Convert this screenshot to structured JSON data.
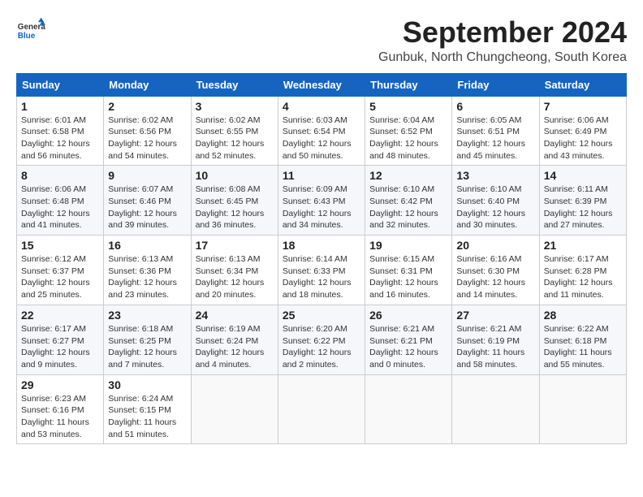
{
  "logo": {
    "general": "General",
    "blue": "Blue"
  },
  "header": {
    "month": "September 2024",
    "location": "Gunbuk, North Chungcheong, South Korea"
  },
  "weekdays": [
    "Sunday",
    "Monday",
    "Tuesday",
    "Wednesday",
    "Thursday",
    "Friday",
    "Saturday"
  ],
  "weeks": [
    [
      {
        "day": "1",
        "sunrise": "6:01 AM",
        "sunset": "6:58 PM",
        "daylight": "12 hours and 56 minutes."
      },
      {
        "day": "2",
        "sunrise": "6:02 AM",
        "sunset": "6:56 PM",
        "daylight": "12 hours and 54 minutes."
      },
      {
        "day": "3",
        "sunrise": "6:02 AM",
        "sunset": "6:55 PM",
        "daylight": "12 hours and 52 minutes."
      },
      {
        "day": "4",
        "sunrise": "6:03 AM",
        "sunset": "6:54 PM",
        "daylight": "12 hours and 50 minutes."
      },
      {
        "day": "5",
        "sunrise": "6:04 AM",
        "sunset": "6:52 PM",
        "daylight": "12 hours and 48 minutes."
      },
      {
        "day": "6",
        "sunrise": "6:05 AM",
        "sunset": "6:51 PM",
        "daylight": "12 hours and 45 minutes."
      },
      {
        "day": "7",
        "sunrise": "6:06 AM",
        "sunset": "6:49 PM",
        "daylight": "12 hours and 43 minutes."
      }
    ],
    [
      {
        "day": "8",
        "sunrise": "6:06 AM",
        "sunset": "6:48 PM",
        "daylight": "12 hours and 41 minutes."
      },
      {
        "day": "9",
        "sunrise": "6:07 AM",
        "sunset": "6:46 PM",
        "daylight": "12 hours and 39 minutes."
      },
      {
        "day": "10",
        "sunrise": "6:08 AM",
        "sunset": "6:45 PM",
        "daylight": "12 hours and 36 minutes."
      },
      {
        "day": "11",
        "sunrise": "6:09 AM",
        "sunset": "6:43 PM",
        "daylight": "12 hours and 34 minutes."
      },
      {
        "day": "12",
        "sunrise": "6:10 AM",
        "sunset": "6:42 PM",
        "daylight": "12 hours and 32 minutes."
      },
      {
        "day": "13",
        "sunrise": "6:10 AM",
        "sunset": "6:40 PM",
        "daylight": "12 hours and 30 minutes."
      },
      {
        "day": "14",
        "sunrise": "6:11 AM",
        "sunset": "6:39 PM",
        "daylight": "12 hours and 27 minutes."
      }
    ],
    [
      {
        "day": "15",
        "sunrise": "6:12 AM",
        "sunset": "6:37 PM",
        "daylight": "12 hours and 25 minutes."
      },
      {
        "day": "16",
        "sunrise": "6:13 AM",
        "sunset": "6:36 PM",
        "daylight": "12 hours and 23 minutes."
      },
      {
        "day": "17",
        "sunrise": "6:13 AM",
        "sunset": "6:34 PM",
        "daylight": "12 hours and 20 minutes."
      },
      {
        "day": "18",
        "sunrise": "6:14 AM",
        "sunset": "6:33 PM",
        "daylight": "12 hours and 18 minutes."
      },
      {
        "day": "19",
        "sunrise": "6:15 AM",
        "sunset": "6:31 PM",
        "daylight": "12 hours and 16 minutes."
      },
      {
        "day": "20",
        "sunrise": "6:16 AM",
        "sunset": "6:30 PM",
        "daylight": "12 hours and 14 minutes."
      },
      {
        "day": "21",
        "sunrise": "6:17 AM",
        "sunset": "6:28 PM",
        "daylight": "12 hours and 11 minutes."
      }
    ],
    [
      {
        "day": "22",
        "sunrise": "6:17 AM",
        "sunset": "6:27 PM",
        "daylight": "12 hours and 9 minutes."
      },
      {
        "day": "23",
        "sunrise": "6:18 AM",
        "sunset": "6:25 PM",
        "daylight": "12 hours and 7 minutes."
      },
      {
        "day": "24",
        "sunrise": "6:19 AM",
        "sunset": "6:24 PM",
        "daylight": "12 hours and 4 minutes."
      },
      {
        "day": "25",
        "sunrise": "6:20 AM",
        "sunset": "6:22 PM",
        "daylight": "12 hours and 2 minutes."
      },
      {
        "day": "26",
        "sunrise": "6:21 AM",
        "sunset": "6:21 PM",
        "daylight": "12 hours and 0 minutes."
      },
      {
        "day": "27",
        "sunrise": "6:21 AM",
        "sunset": "6:19 PM",
        "daylight": "11 hours and 58 minutes."
      },
      {
        "day": "28",
        "sunrise": "6:22 AM",
        "sunset": "6:18 PM",
        "daylight": "11 hours and 55 minutes."
      }
    ],
    [
      {
        "day": "29",
        "sunrise": "6:23 AM",
        "sunset": "6:16 PM",
        "daylight": "11 hours and 53 minutes."
      },
      {
        "day": "30",
        "sunrise": "6:24 AM",
        "sunset": "6:15 PM",
        "daylight": "11 hours and 51 minutes."
      },
      null,
      null,
      null,
      null,
      null
    ]
  ]
}
